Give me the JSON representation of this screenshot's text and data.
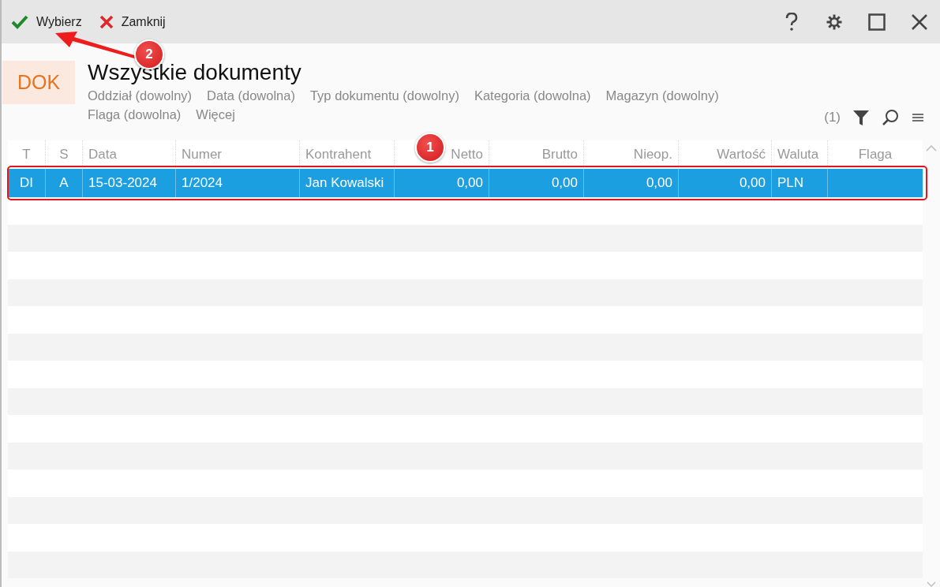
{
  "toolbar": {
    "actions": [
      {
        "kind": "confirm",
        "label": "Wybierz"
      },
      {
        "kind": "close",
        "label": "Zamknij"
      }
    ]
  },
  "header": {
    "badge": "DOK",
    "title": "Wszystkie dokumenty",
    "filters": [
      "Oddział (dowolny)",
      "Data (dowolna)",
      "Typ dokumentu (dowolny)",
      "Kategoria (dowolna)",
      "Magazyn (dowolny)",
      "Flaga (dowolna)",
      "Więcej"
    ],
    "count": "(1)"
  },
  "table": {
    "columns": [
      {
        "label": "T"
      },
      {
        "label": "S"
      },
      {
        "label": "Data"
      },
      {
        "label": "Numer"
      },
      {
        "label": "Kontrahent"
      },
      {
        "label": "Netto"
      },
      {
        "label": "Brutto"
      },
      {
        "label": "Nieop."
      },
      {
        "label": "Wartość"
      },
      {
        "label": "Waluta"
      },
      {
        "label": "Flaga"
      }
    ],
    "rows": [
      {
        "selected": true,
        "cells": [
          "DI",
          "A",
          "15-03-2024",
          "1/2024",
          "Jan Kowalski",
          "0,00",
          "0,00",
          "0,00",
          "0,00",
          "PLN",
          null
        ]
      }
    ]
  },
  "annotations": [
    {
      "label": "1"
    },
    {
      "label": "2"
    }
  ]
}
